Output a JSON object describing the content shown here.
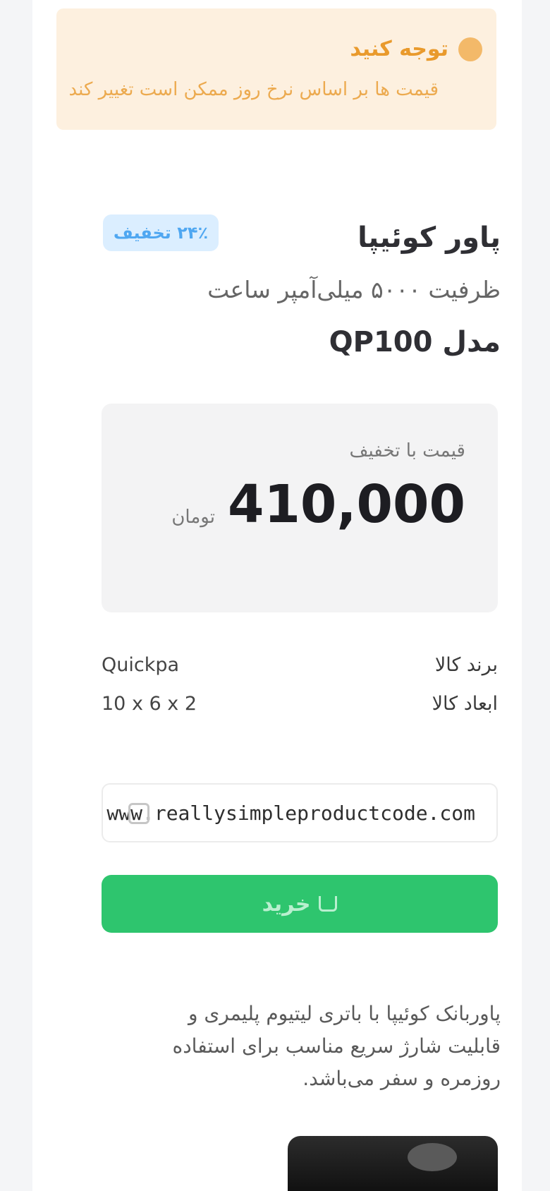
{
  "notice": {
    "title": "توجه کنید",
    "text": "قیمت ها بر اساس نرخ روز ممکن است تغییر کند"
  },
  "product": {
    "title_main": "پاور کوئیپا",
    "title_sub": "ظرفیت ۵۰۰۰ میلی‌آمپر ساعت",
    "title_tail": "مدل QP100",
    "badge": "۲۴٪ تخفیف"
  },
  "price": {
    "label": "قیمت با تخفیف",
    "value": "410,000",
    "currency": "تومان"
  },
  "info": [
    {
      "key": "برند کالا",
      "value": "Quickpa"
    },
    {
      "key": "ابعاد کالا",
      "value": "10 x 6 x 2"
    }
  ],
  "code": {
    "text": "www.reallysimpleproductcode.com"
  },
  "buy_button": {
    "label": "خرید"
  },
  "description": {
    "text": "پاوربانک کوئیپا با باتری لیتیوم پلیمری و قابلیت شارژ سریع مناسب برای استفاده روزمره و سفر می‌باشد."
  }
}
